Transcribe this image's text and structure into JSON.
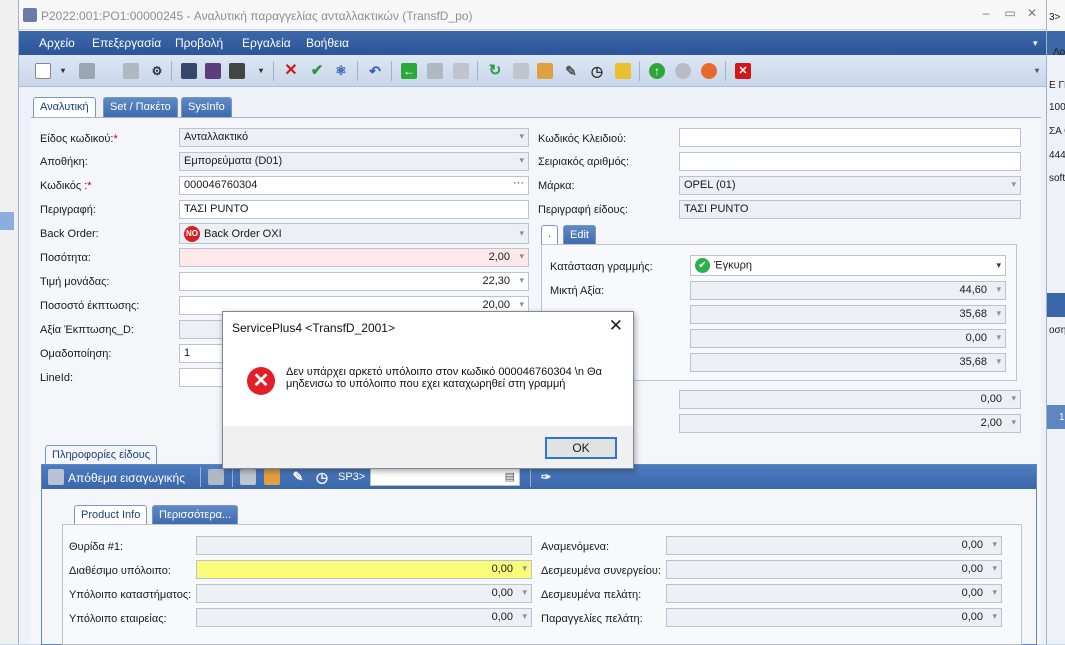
{
  "window": {
    "title": "P2022:001:PO1:00000245 - Αναλυτική παραγγελίας ανταλλακτικών (TransfD_po)"
  },
  "menu": [
    "Αρχείο",
    "Επεξεργασία",
    "Προβολή",
    "Εργαλεία",
    "Βοήθεια"
  ],
  "tabs": {
    "main": [
      "Αναλυτική",
      "Set / Πακέτο",
      "SysInfo"
    ],
    "line": [
      ".",
      "Edit"
    ],
    "info": [
      "Πληροφορίες είδους"
    ],
    "product": [
      "Product Info",
      "Περισσότερα..."
    ]
  },
  "form_left": {
    "type_label": "Είδος κωδικού:",
    "type_value": "Ανταλλακτικό",
    "warehouse_label": "Αποθήκη:",
    "warehouse_value": "Εμπορεύματα (D01)",
    "code_label": "Κωδικός :",
    "code_value": "000046760304",
    "description_label": "Περιγραφή:",
    "description_value": "ΤΑΣΙ PUNTO",
    "backorder_label": "Back Order:",
    "backorder_value": "Back Order OXI",
    "backorder_badge": "NO",
    "qty_label": "Ποσότητα:",
    "qty_value": "2,00",
    "unit_price_label": "Τιμή μονάδας:",
    "unit_price_value": "22,30",
    "discount_pct_label": "Ποσοστό έκπτωσης:",
    "discount_pct_value": "20,00",
    "discount_value_label": "Αξία Έκπτωσης_D:",
    "grouping_label": "Ομαδοποίηση:",
    "grouping_value": "1",
    "lineid_label": "LineId:"
  },
  "form_right": {
    "key_code_label": "Κωδικός Κλειδιού:",
    "serial_label": "Σειριακός αριθμός:",
    "brand_label": "Μάρκα:",
    "brand_value": "OPEL (01)",
    "item_desc_label": "Περιγραφή είδους:",
    "item_desc_value": "ΤΑΣΙ PUNTO",
    "line_status_label": "Κατάσταση γραμμής:",
    "line_status_value": "Έγκυρη",
    "gross_label": "Μικτή Αξία:",
    "gross_value": "44,60",
    "net_value": "35,68",
    "zero_value": "0,00",
    "net_value_2": "35,68",
    "extra_value_1": "0,00",
    "extra_value_2": "2,00"
  },
  "info_bar": {
    "stock_label": "Απόθεμα εισαγωγικής",
    "sp_label": "SP3>"
  },
  "product_info": {
    "shelf_label": "Θυρίδα #1:",
    "available_label": "Διαθέσιμο υπόλοιπο:",
    "available_value": "0,00",
    "store_balance_label": "Υπόλοιπο καταστήματος:",
    "store_balance_value": "0,00",
    "company_balance_label": "Υπόλοιπο εταιρείας:",
    "company_balance_value": "0,00",
    "expected_label": "Αναμενόμενα:",
    "expected_value": "0,00",
    "reserved_partner_label": "Δεσμευμένα συνεργείου:",
    "reserved_partner_value": "0,00",
    "reserved_customer_label": "Δεσμευμένα πελάτη:",
    "reserved_customer_value": "0,00",
    "customer_orders_label": "Παραγγελίες πελάτη:",
    "customer_orders_value": "0,00"
  },
  "right_app": {
    "texts": [
      "3>",
      "Λο",
      "Ε ΓΕ",
      "100",
      "ΣΑ Ο",
      "444",
      "soft",
      "οση",
      "1"
    ]
  },
  "dialog": {
    "title": "ServicePlus4  <TransfD_2001>",
    "message": "Δεν υπάρχει αρκετό υπόλοιπο στον κωδικό 000046760304 \\n Θα μηδενισω το υπόλοιπο που εχει καταχωρηθεί στη γραμμή",
    "ok_label": "OK"
  },
  "colors": {
    "accent": "#3c68a8",
    "error": "#e41e26",
    "highlight_yellow": "#fbfb7a",
    "highlight_pink": "#fde8ea"
  }
}
